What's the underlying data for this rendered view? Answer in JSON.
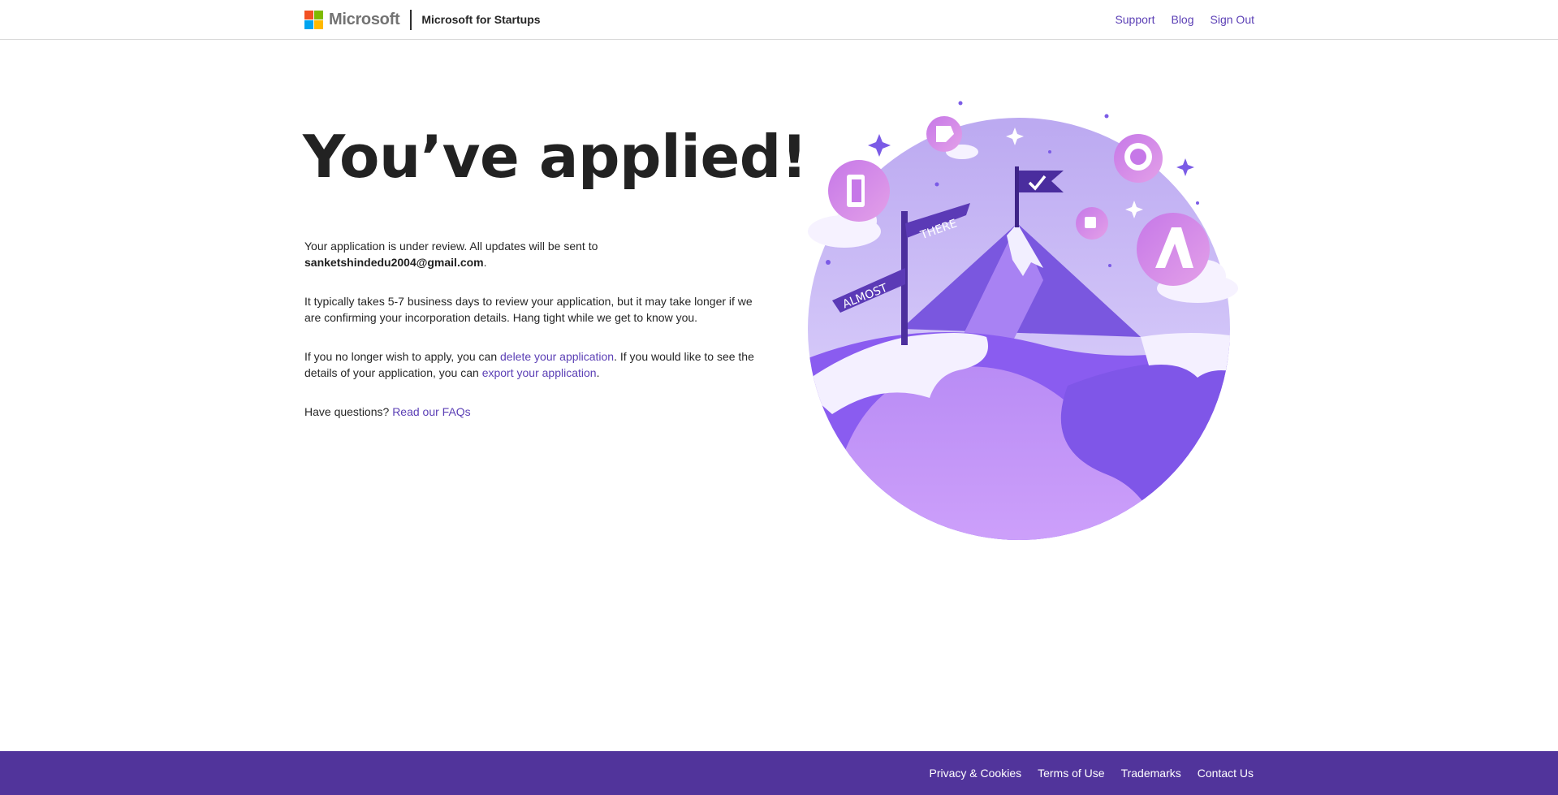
{
  "header": {
    "brand": "Microsoft",
    "product": "Microsoft for Startups",
    "nav": [
      "Support",
      "Blog",
      "Sign Out"
    ]
  },
  "main": {
    "headline": "You’ve applied!",
    "p1_text": "Your application is under review. All updates will be sent to",
    "email": "sanketshindedu2004@gmail.com",
    "p1_end": ".",
    "p2": "It typically takes 5-7 business days to review your application, but it may take longer if we are confirming your incorporation details. Hang tight while we get to know you.",
    "p3_a": "If you no longer wish to apply, you can ",
    "p3_link1": "delete your application",
    "p3_b": ". If you would like to see the details of your application, you can ",
    "p3_link2": "export your application",
    "p3_c": ".",
    "p4_a": "Have questions? ",
    "p4_link": "Read our FAQs"
  },
  "illustration": {
    "sign_top": "THERE",
    "sign_bottom": "ALMOST",
    "icons": [
      "office-icon",
      "github-icon",
      "azure-icon",
      "teams-icon",
      "power-automate-icon",
      "flag-check-icon"
    ]
  },
  "footer": {
    "links": [
      "Privacy & Cookies",
      "Terms of Use",
      "Trademarks",
      "Contact Us"
    ]
  },
  "colors": {
    "accent": "#5b3fb5",
    "footer_bg": "#51349b",
    "ms_red": "#f25022",
    "ms_green": "#7fba00",
    "ms_blue": "#00a4ef",
    "ms_yellow": "#ffb900"
  }
}
